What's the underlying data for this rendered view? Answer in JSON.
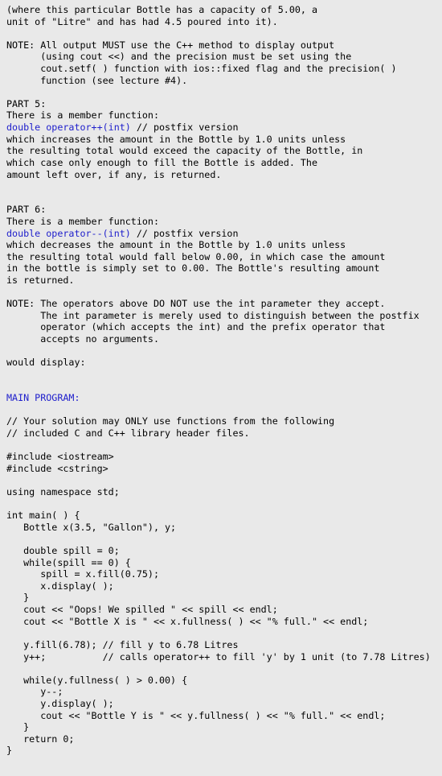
{
  "document": {
    "kind": "assignment-specification-text",
    "background_color": "#e9e9e9",
    "text_color": "#000000",
    "accent_color": "#2020cc",
    "lines": [
      {
        "id": "l001",
        "text": "(where this particular Bottle has a capacity of 5.00, a",
        "style": "plain"
      },
      {
        "id": "l002",
        "text": "unit of \"Litre\" and has had 4.5 poured into it).",
        "style": "plain"
      },
      {
        "id": "l003",
        "text": "",
        "style": "blank"
      },
      {
        "id": "l004",
        "text": "NOTE: All output MUST use the C++ method to display output",
        "style": "plain"
      },
      {
        "id": "l005",
        "text": "      (using cout <<) and the precision must be set using the",
        "style": "plain"
      },
      {
        "id": "l006",
        "text": "      cout.setf( ) function with ios::fixed flag and the precision( )",
        "style": "plain"
      },
      {
        "id": "l007",
        "text": "      function (see lecture #4).",
        "style": "plain"
      },
      {
        "id": "l008",
        "text": "",
        "style": "blank"
      },
      {
        "id": "l009",
        "text": "PART 5:",
        "style": "plain"
      },
      {
        "id": "l010",
        "text": "There is a member function:",
        "style": "plain"
      },
      {
        "id": "l011",
        "style": "split",
        "accent_text": "double operator++(int)",
        "plain_text": " // postfix version"
      },
      {
        "id": "l012",
        "text": "which increases the amount in the Bottle by 1.0 units unless",
        "style": "plain"
      },
      {
        "id": "l013",
        "text": "the resulting total would exceed the capacity of the Bottle, in",
        "style": "plain"
      },
      {
        "id": "l014",
        "text": "which case only enough to fill the Bottle is added. The",
        "style": "plain"
      },
      {
        "id": "l015",
        "text": "amount left over, if any, is returned.",
        "style": "plain"
      },
      {
        "id": "l016",
        "text": "",
        "style": "blank"
      },
      {
        "id": "l017",
        "text": "",
        "style": "blank"
      },
      {
        "id": "l018",
        "text": "PART 6:",
        "style": "plain"
      },
      {
        "id": "l019",
        "text": "There is a member function:",
        "style": "plain"
      },
      {
        "id": "l020",
        "style": "split",
        "accent_text": "double operator--(int)",
        "plain_text": " // postfix version"
      },
      {
        "id": "l021",
        "text": "which decreases the amount in the Bottle by 1.0 units unless",
        "style": "plain"
      },
      {
        "id": "l022",
        "text": "the resulting total would fall below 0.00, in which case the amount",
        "style": "plain"
      },
      {
        "id": "l023",
        "text": "in the bottle is simply set to 0.00. The Bottle's resulting amount",
        "style": "plain"
      },
      {
        "id": "l024",
        "text": "is returned.",
        "style": "plain"
      },
      {
        "id": "l025",
        "text": "",
        "style": "blank"
      },
      {
        "id": "l026",
        "text": "NOTE: The operators above DO NOT use the int parameter they accept.",
        "style": "plain"
      },
      {
        "id": "l027",
        "text": "      The int parameter is merely used to distinguish between the postfix",
        "style": "plain"
      },
      {
        "id": "l028",
        "text": "      operator (which accepts the int) and the prefix operator that",
        "style": "plain"
      },
      {
        "id": "l029",
        "text": "      accepts no arguments.",
        "style": "plain"
      },
      {
        "id": "l030",
        "text": "",
        "style": "blank"
      },
      {
        "id": "l031",
        "text": "would display:",
        "style": "plain"
      },
      {
        "id": "l032",
        "text": "",
        "style": "blank"
      },
      {
        "id": "l033",
        "text": "",
        "style": "blank"
      },
      {
        "id": "l034",
        "text": "MAIN PROGRAM:",
        "style": "accent"
      },
      {
        "id": "l035",
        "text": "",
        "style": "blank"
      },
      {
        "id": "l036",
        "text": "// Your solution may ONLY use functions from the following",
        "style": "plain"
      },
      {
        "id": "l037",
        "text": "// included C and C++ library header files.",
        "style": "plain"
      },
      {
        "id": "l038",
        "text": "",
        "style": "blank"
      },
      {
        "id": "l039",
        "text": "#include <iostream>",
        "style": "plain"
      },
      {
        "id": "l040",
        "text": "#include <cstring>",
        "style": "plain"
      },
      {
        "id": "l041",
        "text": "",
        "style": "blank"
      },
      {
        "id": "l042",
        "text": "using namespace std;",
        "style": "plain"
      },
      {
        "id": "l043",
        "text": "",
        "style": "blank"
      },
      {
        "id": "l044",
        "text": "int main( ) {",
        "style": "plain"
      },
      {
        "id": "l045",
        "text": "   Bottle x(3.5, \"Gallon\"), y;",
        "style": "plain"
      },
      {
        "id": "l046",
        "text": "",
        "style": "blank"
      },
      {
        "id": "l047",
        "text": "   double spill = 0;",
        "style": "plain"
      },
      {
        "id": "l048",
        "text": "   while(spill == 0) {",
        "style": "plain"
      },
      {
        "id": "l049",
        "text": "      spill = x.fill(0.75);",
        "style": "plain"
      },
      {
        "id": "l050",
        "text": "      x.display( );",
        "style": "plain"
      },
      {
        "id": "l051",
        "text": "   }",
        "style": "plain"
      },
      {
        "id": "l052",
        "text": "   cout << \"Oops! We spilled \" << spill << endl;",
        "style": "plain"
      },
      {
        "id": "l053",
        "text": "   cout << \"Bottle X is \" << x.fullness( ) << \"% full.\" << endl;",
        "style": "plain"
      },
      {
        "id": "l054",
        "text": "",
        "style": "blank"
      },
      {
        "id": "l055",
        "text": "   y.fill(6.78); // fill y to 6.78 Litres",
        "style": "plain"
      },
      {
        "id": "l056",
        "text": "   y++;          // calls operator++ to fill 'y' by 1 unit (to 7.78 Litres)",
        "style": "plain"
      },
      {
        "id": "l057",
        "text": "",
        "style": "blank"
      },
      {
        "id": "l058",
        "text": "   while(y.fullness( ) > 0.00) {",
        "style": "plain"
      },
      {
        "id": "l059",
        "text": "      y--;",
        "style": "plain"
      },
      {
        "id": "l060",
        "text": "      y.display( );",
        "style": "plain"
      },
      {
        "id": "l061",
        "text": "      cout << \"Bottle Y is \" << y.fullness( ) << \"% full.\" << endl;",
        "style": "plain"
      },
      {
        "id": "l062",
        "text": "   }",
        "style": "plain"
      },
      {
        "id": "l063",
        "text": "   return 0;",
        "style": "plain"
      },
      {
        "id": "l064",
        "text": "}",
        "style": "plain"
      }
    ]
  }
}
